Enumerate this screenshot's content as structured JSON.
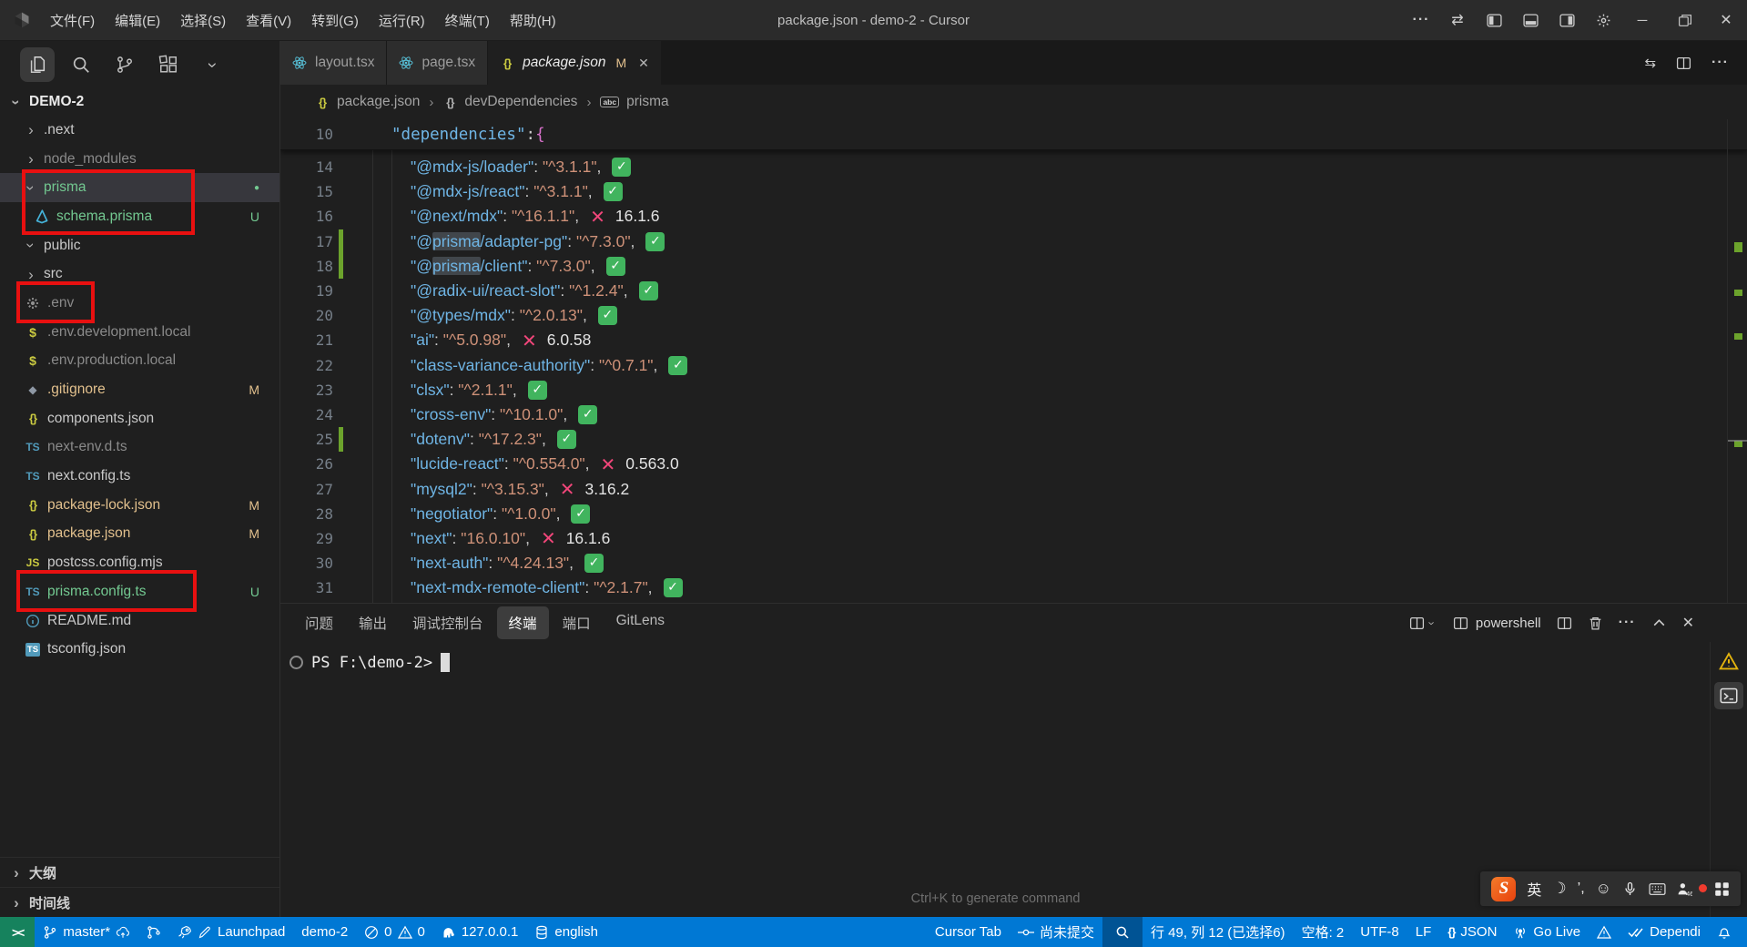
{
  "colors": {
    "accent": "#0078d4",
    "remote_green": "#16825d",
    "modified": "#e2c08d",
    "untracked": "#73c991",
    "dim": "#8a8a8a",
    "error_x": "#f1467a",
    "check_green": "#41b45e",
    "change_bar": "#6ca32c",
    "annotation_red": "#e81010"
  },
  "title_bar": {
    "title": "package.json - demo-2 - Cursor",
    "menus": [
      "文件(F)",
      "编辑(E)",
      "选择(S)",
      "查看(V)",
      "转到(G)",
      "运行(R)",
      "终端(T)",
      "帮助(H)"
    ],
    "right_icons": [
      "more",
      "layout-switch",
      "panel-left",
      "panel-bottom",
      "panel-right",
      "settings"
    ],
    "window_controls": [
      "minimize",
      "restore",
      "close"
    ]
  },
  "activity_bar": {
    "icons": [
      {
        "name": "explorer-icon",
        "active": true
      },
      {
        "name": "search-icon"
      },
      {
        "name": "source-control-icon"
      },
      {
        "name": "extensions-icon"
      },
      {
        "name": "chevron-down-icon"
      }
    ]
  },
  "explorer": {
    "root": "DEMO-2",
    "items": [
      {
        "label": ".next",
        "chevron": "right",
        "type": "folder"
      },
      {
        "label": "node_modules",
        "chevron": "right",
        "type": "folder",
        "dim": true
      },
      {
        "label": "prisma",
        "chevron": "down",
        "type": "folder",
        "color": "untracked",
        "selected": true,
        "badge": "dot"
      },
      {
        "label": "schema.prisma",
        "icon": "prisma",
        "depth": 2,
        "color": "untracked",
        "badge": "U"
      },
      {
        "label": "public",
        "chevron": "down",
        "type": "folder"
      },
      {
        "label": "src",
        "chevron": "right",
        "type": "folder"
      },
      {
        "label": ".env",
        "icon": "gear",
        "dim": true
      },
      {
        "label": ".env.development.local",
        "icon": "dollar",
        "dim": true
      },
      {
        "label": ".env.production.local",
        "icon": "dollar",
        "dim": true
      },
      {
        "label": ".gitignore",
        "icon": "diamond",
        "color": "modified",
        "badge": "M"
      },
      {
        "label": "components.json",
        "icon": "braces"
      },
      {
        "label": "next-env.d.ts",
        "icon": "ts",
        "dim": true
      },
      {
        "label": "next.config.ts",
        "icon": "ts"
      },
      {
        "label": "package-lock.json",
        "icon": "braces",
        "color": "modified",
        "badge": "M"
      },
      {
        "label": "package.json",
        "icon": "braces",
        "color": "modified",
        "badge": "M"
      },
      {
        "label": "postcss.config.mjs",
        "icon": "js"
      },
      {
        "label": "prisma.config.ts",
        "icon": "ts",
        "color": "untracked",
        "badge": "U"
      },
      {
        "label": "README.md",
        "icon": "info"
      },
      {
        "label": "tsconfig.json",
        "icon": "tsconfig"
      }
    ],
    "bottom_sections": [
      "大纲",
      "时间线"
    ]
  },
  "tabs": [
    {
      "label": "layout.tsx",
      "icon": "react"
    },
    {
      "label": "page.tsx",
      "icon": "react"
    },
    {
      "label": "package.json",
      "icon": "braces",
      "active": true,
      "badge": "M",
      "closable": true
    }
  ],
  "tab_actions": [
    "compare-changes-icon",
    "split-editor-icon",
    "more-actions-icon"
  ],
  "breadcrumb": [
    {
      "label": "package.json",
      "icon": "braces"
    },
    {
      "label": "devDependencies",
      "icon": "braces-grey"
    },
    {
      "label": "prisma",
      "icon": "abc"
    }
  ],
  "editor": {
    "sticky": {
      "n": 10,
      "key": "dependencies",
      "brace": "{"
    },
    "lines": [
      {
        "n": 14,
        "key": "@mdx-js/loader",
        "value": "^3.1.1",
        "status": "ok"
      },
      {
        "n": 15,
        "key": "@mdx-js/react",
        "value": "^3.1.1",
        "status": "ok"
      },
      {
        "n": 16,
        "key": "@next/mdx",
        "value": "^16.1.1",
        "status": "outdated",
        "latest": "16.1.6"
      },
      {
        "n": 17,
        "key": "@prisma/adapter-pg",
        "value": "^7.3.0",
        "status": "ok",
        "changed": true,
        "highlight": "prisma"
      },
      {
        "n": 18,
        "key": "@prisma/client",
        "value": "^7.3.0",
        "status": "ok",
        "changed": true,
        "highlight": "prisma"
      },
      {
        "n": 19,
        "key": "@radix-ui/react-slot",
        "value": "^1.2.4",
        "status": "ok"
      },
      {
        "n": 20,
        "key": "@types/mdx",
        "value": "^2.0.13",
        "status": "ok"
      },
      {
        "n": 21,
        "key": "ai",
        "value": "^5.0.98",
        "status": "outdated",
        "latest": "6.0.58"
      },
      {
        "n": 22,
        "key": "class-variance-authority",
        "value": "^0.7.1",
        "status": "ok"
      },
      {
        "n": 23,
        "key": "clsx",
        "value": "^2.1.1",
        "status": "ok"
      },
      {
        "n": 24,
        "key": "cross-env",
        "value": "^10.1.0",
        "status": "ok"
      },
      {
        "n": 25,
        "key": "dotenv",
        "value": "^17.2.3",
        "status": "ok",
        "changed": true
      },
      {
        "n": 26,
        "key": "lucide-react",
        "value": "^0.554.0",
        "status": "outdated",
        "latest": "0.563.0"
      },
      {
        "n": 27,
        "key": "mysql2",
        "value": "^3.15.3",
        "status": "outdated",
        "latest": "3.16.2"
      },
      {
        "n": 28,
        "key": "negotiator",
        "value": "^1.0.0",
        "status": "ok"
      },
      {
        "n": 29,
        "key": "next",
        "value": "16.0.10",
        "status": "outdated",
        "latest": "16.1.6"
      },
      {
        "n": 30,
        "key": "next-auth",
        "value": "^4.24.13",
        "status": "ok"
      },
      {
        "n": 31,
        "key": "next-mdx-remote-client",
        "value": "^2.1.7",
        "status": "ok"
      }
    ],
    "changed_lines": [
      17,
      18,
      25
    ]
  },
  "panel": {
    "tabs": [
      {
        "label": "问题"
      },
      {
        "label": "输出"
      },
      {
        "label": "调试控制台"
      },
      {
        "label": "终端",
        "active": true
      },
      {
        "label": "端口"
      },
      {
        "label": "GitLens"
      }
    ],
    "shell_label": "powershell",
    "prompt": "PS F:\\demo-2>",
    "hint": "Ctrl+K to generate command"
  },
  "status_bar": {
    "left": [
      {
        "name": "remote-indicator",
        "style": "remote",
        "parts": [
          {
            "icon": "remote"
          }
        ]
      },
      {
        "name": "git-branch",
        "parts": [
          {
            "icon": "branch"
          },
          {
            "text": "master*"
          },
          {
            "icon": "cloud-up"
          }
        ]
      },
      {
        "name": "gitlens-graph",
        "parts": [
          {
            "icon": "graph"
          }
        ]
      },
      {
        "name": "gitlens-launchpad",
        "parts": [
          {
            "icon": "rocket"
          },
          {
            "icon": "pen"
          },
          {
            "text": "Launchpad"
          }
        ]
      },
      {
        "name": "project-name",
        "parts": [
          {
            "text": "demo-2"
          }
        ]
      },
      {
        "name": "problems",
        "parts": [
          {
            "icon": "error"
          },
          {
            "text": "0"
          },
          {
            "icon": "warn"
          },
          {
            "text": "0"
          }
        ]
      },
      {
        "name": "postgres-host",
        "parts": [
          {
            "icon": "elephant"
          },
          {
            "text": "127.0.0.1"
          }
        ]
      },
      {
        "name": "database-connection",
        "parts": [
          {
            "icon": "database"
          },
          {
            "text": "english"
          }
        ]
      }
    ],
    "right": [
      {
        "name": "cursor-tab",
        "parts": [
          {
            "text": "Cursor Tab"
          }
        ]
      },
      {
        "name": "commit-status",
        "parts": [
          {
            "icon": "commit"
          },
          {
            "text": "尚未提交"
          }
        ]
      },
      {
        "name": "search-mode",
        "style": "boxed",
        "parts": [
          {
            "icon": "magnifier"
          }
        ]
      },
      {
        "name": "cursor-position",
        "parts": [
          {
            "text": "行 49, 列 12 (已选择6)"
          }
        ]
      },
      {
        "name": "indentation",
        "parts": [
          {
            "text": "空格: 2"
          }
        ]
      },
      {
        "name": "encoding",
        "parts": [
          {
            "text": "UTF-8"
          }
        ]
      },
      {
        "name": "eol",
        "parts": [
          {
            "text": "LF"
          }
        ]
      },
      {
        "name": "language-mode",
        "parts": [
          {
            "icon": "braces-white"
          },
          {
            "text": "JSON"
          }
        ]
      },
      {
        "name": "go-live",
        "parts": [
          {
            "icon": "broadcast"
          },
          {
            "text": "Go Live"
          }
        ]
      },
      {
        "name": "warning-indicator",
        "parts": [
          {
            "icon": "warn"
          }
        ]
      },
      {
        "name": "dependi",
        "parts": [
          {
            "icon": "double-check"
          },
          {
            "text": "Dependi"
          }
        ]
      },
      {
        "name": "notifications-bell",
        "parts": [
          {
            "icon": "bell"
          }
        ]
      }
    ]
  },
  "ime_bar": {
    "items": [
      {
        "name": "sogou-logo",
        "text": "S"
      },
      {
        "name": "lang-indicator",
        "text": "英"
      },
      {
        "name": "moon-icon"
      },
      {
        "name": "punctuation-indicator",
        "text": "’,"
      },
      {
        "name": "emoji-icon"
      },
      {
        "name": "mic-icon"
      },
      {
        "name": "keyboard-icon"
      },
      {
        "name": "person-46-icon"
      },
      {
        "name": "skin-icon"
      },
      {
        "name": "grid-icon"
      }
    ]
  }
}
